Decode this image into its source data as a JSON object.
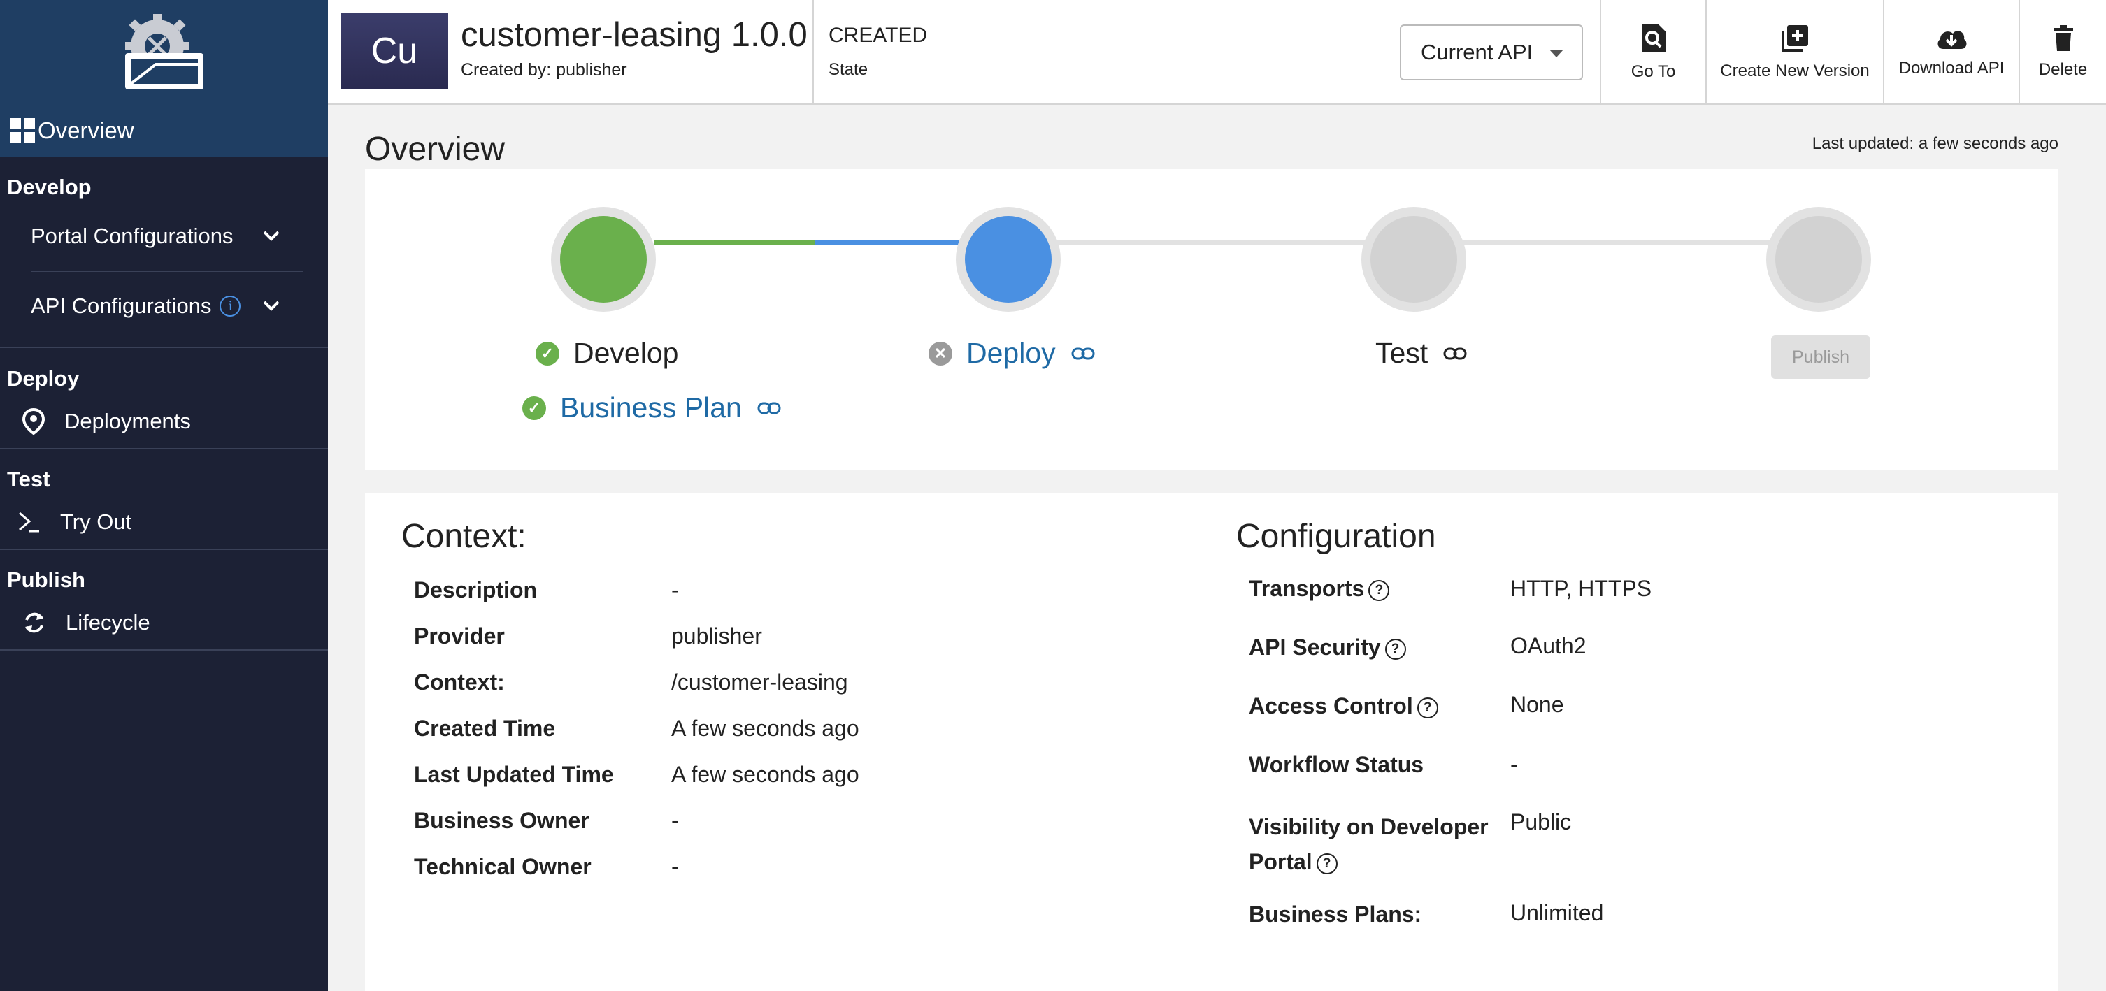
{
  "sidebar": {
    "overview_label": "Overview",
    "sections": {
      "develop": "Develop",
      "deploy": "Deploy",
      "test": "Test",
      "publish": "Publish"
    },
    "items": {
      "portal_configurations": "Portal Configurations",
      "api_configurations": "API Configurations",
      "deployments": "Deployments",
      "try_out": "Try Out",
      "lifecycle": "Lifecycle"
    }
  },
  "header": {
    "avatar_text": "Cu",
    "api_title": "customer-leasing 1.0.0",
    "created_by": "Created by: publisher",
    "state_value": "CREATED",
    "state_label": "State",
    "version_select": "Current API",
    "actions": {
      "go_to": "Go To",
      "create_new_version": "Create New Version",
      "download_api": "Download API",
      "delete": "Delete"
    }
  },
  "main": {
    "title": "Overview",
    "last_updated": "Last updated: a few seconds ago",
    "lifecycle": {
      "develop": "Develop",
      "business_plan": "Business Plan",
      "deploy": "Deploy",
      "test": "Test",
      "publish_button": "Publish"
    },
    "context": {
      "heading": "Context:",
      "rows": [
        {
          "key": "Description",
          "value": "-"
        },
        {
          "key": "Provider",
          "value": "publisher"
        },
        {
          "key": "Context:",
          "value": "/customer-leasing"
        },
        {
          "key": "Created Time",
          "value": "A few seconds ago"
        },
        {
          "key": "Last Updated Time",
          "value": "A few seconds ago"
        },
        {
          "key": "Business Owner",
          "value": "-"
        },
        {
          "key": "Technical Owner",
          "value": "-"
        }
      ]
    },
    "configuration": {
      "heading": "Configuration",
      "transports_key": "Transports",
      "transports_value": "HTTP, HTTPS",
      "api_security_key": "API Security",
      "api_security_value": "OAuth2",
      "access_control_key": "Access Control",
      "access_control_value": "None",
      "workflow_status_key": "Workflow Status",
      "workflow_status_value": "-",
      "visibility_key_line1": "Visibility on Developer",
      "visibility_key_line2": "Portal",
      "visibility_value": "Public",
      "business_plans_key": "Business Plans:",
      "business_plans_value": "Unlimited"
    }
  },
  "colors": {
    "sidebar_bg": "#1c2135",
    "sidebar_active": "#1f3e63",
    "develop_green": "#6ab04c",
    "deploy_blue": "#4a90e2",
    "link_blue": "#1f6aa5"
  },
  "icons": [
    "gear-logo-icon",
    "grid-icon",
    "chevron-down-icon",
    "info-icon",
    "pin-icon",
    "terminal-icon",
    "cycle-icon",
    "search-doc-icon",
    "add-box-icon",
    "cloud-download-icon",
    "trash-icon",
    "check-icon",
    "close-circle-icon",
    "link-icon",
    "help-icon"
  ]
}
